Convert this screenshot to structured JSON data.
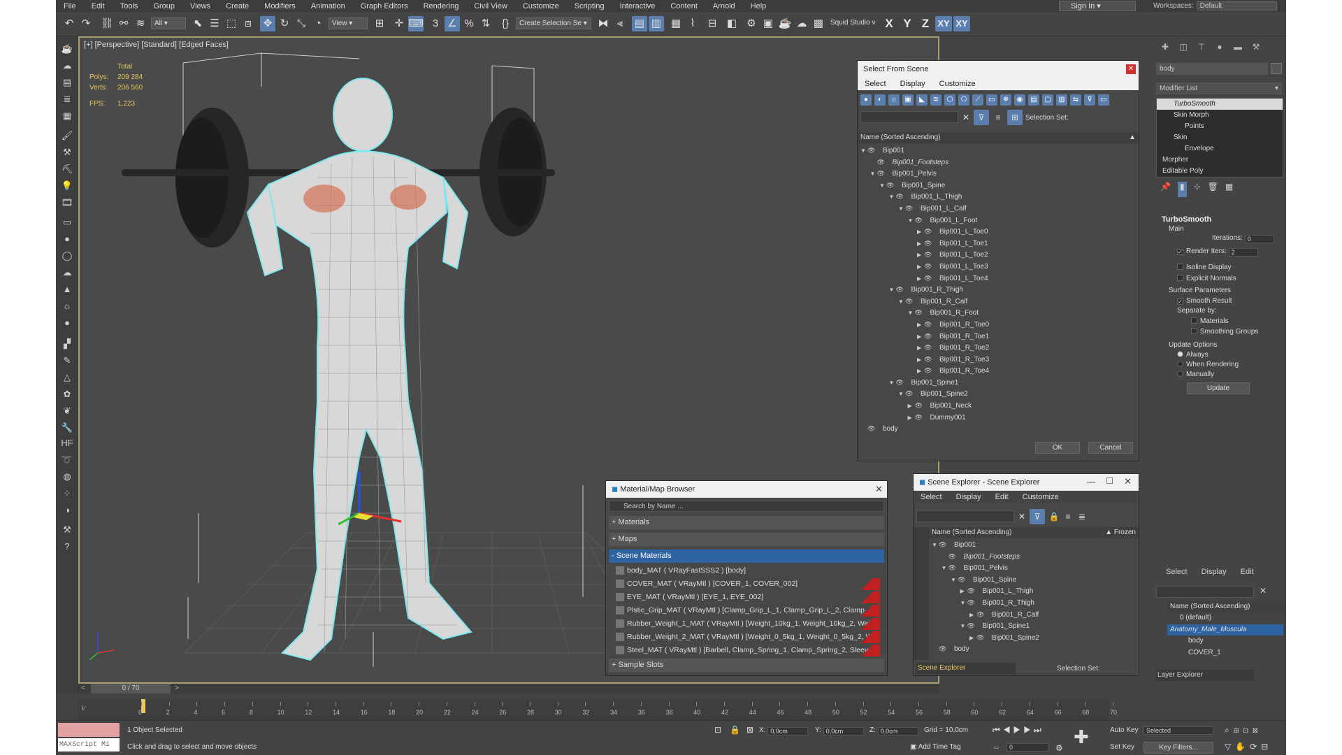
{
  "menu": [
    "File",
    "Edit",
    "Tools",
    "Group",
    "Views",
    "Create",
    "Modifiers",
    "Animation",
    "Graph Editors",
    "Rendering",
    "Civil View",
    "Customize",
    "Scripting",
    "Interactive",
    "Content",
    "Arnold",
    "Help"
  ],
  "sign_in": "Sign In",
  "workspaces_label": "Workspaces:",
  "workspaces_value": "Default",
  "toolbar": {
    "filter_all": "All",
    "view_dropdown": "View",
    "create_selection_set": "Create Selection Se",
    "squid_studio": "Squid Studio v",
    "axis_x": "X",
    "axis_y": "Y",
    "axis_z": "Z",
    "axis_xy": "XY",
    "axis_xy2": "XY"
  },
  "viewport": {
    "label": "[+] [Perspective] [Standard] [Edged Faces]",
    "stats_total": "Total",
    "polys_label": "Polys:",
    "polys": "209 284",
    "verts_label": "Verts:",
    "verts": "206 560",
    "fps_label": "FPS:",
    "fps": "1,223"
  },
  "select_from_scene": {
    "title": "Select From Scene",
    "menu": [
      "Select",
      "Display",
      "Customize"
    ],
    "selection_set_label": "Selection Set:",
    "col_header": "Name (Sorted Ascending)",
    "tree": [
      {
        "d": 0,
        "n": "Bip001",
        "tw": "▼"
      },
      {
        "d": 1,
        "n": "Bip001_Footsteps",
        "tw": "",
        "it": true
      },
      {
        "d": 1,
        "n": "Bip001_Pelvis",
        "tw": "▼"
      },
      {
        "d": 2,
        "n": "Bip001_Spine",
        "tw": "▼"
      },
      {
        "d": 3,
        "n": "Bip001_L_Thigh",
        "tw": "▼"
      },
      {
        "d": 4,
        "n": "Bip001_L_Calf",
        "tw": "▼"
      },
      {
        "d": 5,
        "n": "Bip001_L_Foot",
        "tw": "▼"
      },
      {
        "d": 6,
        "n": "Bip001_L_Toe0",
        "tw": "▶"
      },
      {
        "d": 6,
        "n": "Bip001_L_Toe1",
        "tw": "▶"
      },
      {
        "d": 6,
        "n": "Bip001_L_Toe2",
        "tw": "▶"
      },
      {
        "d": 6,
        "n": "Bip001_L_Toe3",
        "tw": "▶"
      },
      {
        "d": 6,
        "n": "Bip001_L_Toe4",
        "tw": "▶"
      },
      {
        "d": 3,
        "n": "Bip001_R_Thigh",
        "tw": "▼"
      },
      {
        "d": 4,
        "n": "Bip001_R_Calf",
        "tw": "▼"
      },
      {
        "d": 5,
        "n": "Bip001_R_Foot",
        "tw": "▼"
      },
      {
        "d": 6,
        "n": "Bip001_R_Toe0",
        "tw": "▶"
      },
      {
        "d": 6,
        "n": "Bip001_R_Toe1",
        "tw": "▶"
      },
      {
        "d": 6,
        "n": "Bip001_R_Toe2",
        "tw": "▶"
      },
      {
        "d": 6,
        "n": "Bip001_R_Toe3",
        "tw": "▶"
      },
      {
        "d": 6,
        "n": "Bip001_R_Toe4",
        "tw": "▶"
      },
      {
        "d": 3,
        "n": "Bip001_Spine1",
        "tw": "▼"
      },
      {
        "d": 4,
        "n": "Bip001_Spine2",
        "tw": "▼"
      },
      {
        "d": 5,
        "n": "Bip001_Neck",
        "tw": "▶"
      },
      {
        "d": 5,
        "n": "Dummy001",
        "tw": "▶"
      },
      {
        "d": 0,
        "n": "body",
        "tw": ""
      }
    ],
    "ok": "OK",
    "cancel": "Cancel"
  },
  "material_browser": {
    "title": "Material/Map Browser",
    "search_placeholder": "Search by Name ...",
    "materials": "+ Materials",
    "maps": "+ Maps",
    "scene_materials": "- Scene Materials",
    "items": [
      "body_MAT ( VRayFastSSS2 ) [body]",
      "COVER_MAT ( VRayMtl ) [COVER_1, COVER_002]",
      "EYE_MAT ( VRayMtl ) [EYE_1, EYE_002]",
      "Plstic_Grip_MAT ( VRayMtl ) [Clamp_Grip_L_1, Clamp_Grip_L_2, Clamp_Grip...",
      "Rubber_Weight_1_MAT ( VRayMtl ) [Weight_10kg_1, Weight_10kg_2, Weig...",
      "Rubber_Weight_2_MAT ( VRayMtl ) [Weight_0_5kg_1, Weight_0_5kg_2, W...",
      "Steel_MAT ( VRayMtl ) [Barbell, Clamp_Spring_1, Clamp_Spring_2, Sleeve..."
    ],
    "sample_slots": "+ Sample Slots"
  },
  "scene_explorer": {
    "title": "Scene Explorer - Scene Explorer",
    "menu": [
      "Select",
      "Display",
      "Edit",
      "Customize"
    ],
    "col_header": "Name (Sorted Ascending)",
    "frozen": "▲ Frozen",
    "tree": [
      {
        "d": 0,
        "n": "Bip001",
        "tw": "▼"
      },
      {
        "d": 1,
        "n": "Bip001_Footsteps",
        "tw": "",
        "it": true
      },
      {
        "d": 1,
        "n": "Bip001_Pelvis",
        "tw": "▼"
      },
      {
        "d": 2,
        "n": "Bip001_Spine",
        "tw": "▼"
      },
      {
        "d": 3,
        "n": "Bip001_L_Thigh",
        "tw": "▶"
      },
      {
        "d": 3,
        "n": "Bip001_R_Thigh",
        "tw": "▼"
      },
      {
        "d": 4,
        "n": "Bip001_R_Calf",
        "tw": "▶"
      },
      {
        "d": 3,
        "n": "Bip001_Spine1",
        "tw": "▼"
      },
      {
        "d": 4,
        "n": "Bip001_Spine2",
        "tw": "▶"
      },
      {
        "d": 0,
        "n": "body",
        "tw": ""
      }
    ],
    "footer_name": "Scene Explorer",
    "selection_set_label": "Selection Set:"
  },
  "command_panel": {
    "object_name": "body",
    "modifier_list": "Modifier List",
    "stack": [
      "TurboSmooth",
      "Skin Morph",
      "Points",
      "Skin",
      "Envelope",
      "Morpher",
      "Editable Poly"
    ],
    "turbosmooth": {
      "title": "TurboSmooth",
      "main": "Main",
      "iterations_label": "Iterations:",
      "iterations": "0",
      "render_iters_label": "Render Iters:",
      "render_iters": "2",
      "isoline": "Isoline Display",
      "explicit_normals": "Explicit Normals",
      "surface_params": "Surface Parameters",
      "smooth_result": "Smooth Result",
      "separate_by": "Separate by:",
      "materials": "Materials",
      "smoothing_groups": "Smoothing Groups",
      "update_options": "Update Options",
      "always": "Always",
      "when_rendering": "When Rendering",
      "manually": "Manually",
      "update": "Update"
    }
  },
  "layer_explorer": {
    "menu": [
      "Select",
      "Display",
      "Edit"
    ],
    "col_header": "Name (Sorted Ascending)",
    "rows": [
      "0 (default)",
      "Anatomy_Male_Muscula",
      "body",
      "COVER_1"
    ],
    "footer": "Layer Explorer"
  },
  "timeline": {
    "slider": "0 / 70",
    "ticks": [
      "0",
      "2",
      "4",
      "6",
      "8",
      "10",
      "12",
      "14",
      "16",
      "18",
      "20",
      "22",
      "24",
      "26",
      "28",
      "30",
      "32",
      "34",
      "36",
      "38",
      "40",
      "42",
      "44",
      "46",
      "48",
      "50",
      "52",
      "54",
      "56",
      "58",
      "60",
      "62",
      "64",
      "66",
      "68",
      "70"
    ]
  },
  "status": {
    "objects_selected": "1 Object Selected",
    "prompt": "Click and drag to select and move objects",
    "maxscript": "MAXScript Mi",
    "x_label": "X:",
    "x": "0,0cm",
    "y_label": "Y:",
    "y": "0,0cm",
    "z_label": "Z:",
    "z": "0,0cm",
    "grid": "Grid = 10,0cm",
    "add_time_tag": "Add Time Tag",
    "auto_key": "Auto Key",
    "selected": "Selected",
    "set_key": "Set Key",
    "key_filters": "Key Filters...",
    "frame": "0"
  }
}
